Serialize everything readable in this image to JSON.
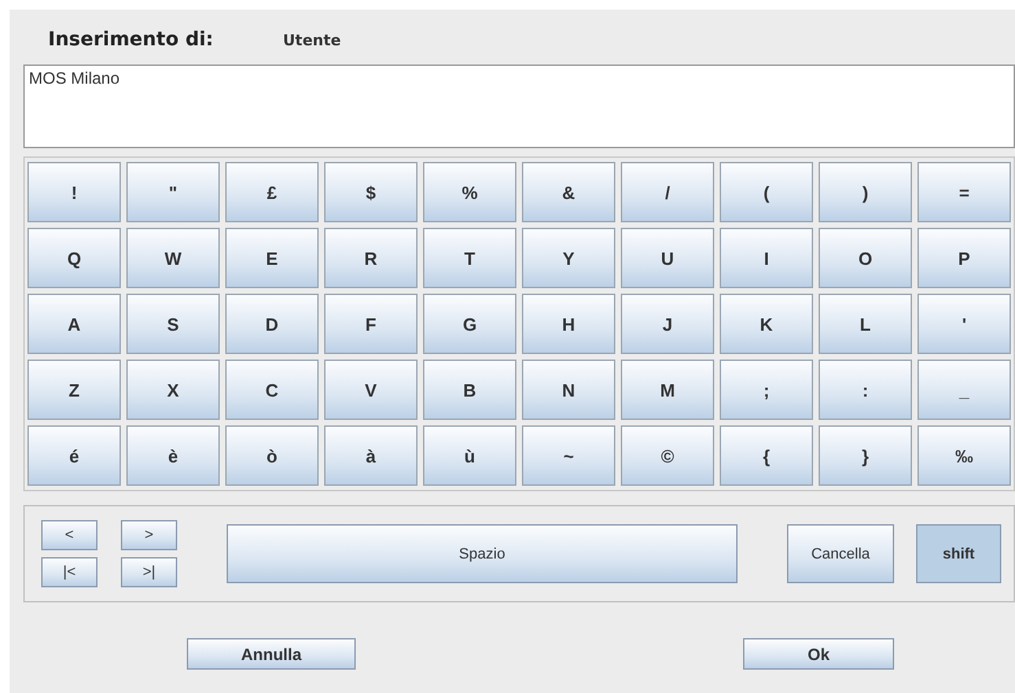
{
  "header": {
    "label": "Inserimento di:",
    "field_name": "Utente"
  },
  "input": {
    "value": "MOS Milano"
  },
  "keys": [
    [
      "!",
      "\"",
      "£",
      "$",
      "%",
      "&",
      "/",
      "(",
      ")",
      "="
    ],
    [
      "Q",
      "W",
      "E",
      "R",
      "T",
      "Y",
      "U",
      "I",
      "O",
      "P"
    ],
    [
      "A",
      "S",
      "D",
      "F",
      "G",
      "H",
      "J",
      "K",
      "L",
      "'"
    ],
    [
      "Z",
      "X",
      "C",
      "V",
      "B",
      "N",
      "M",
      ";",
      ":",
      "_"
    ],
    [
      "é",
      "è",
      "ò",
      "à",
      "ù",
      "~",
      "©",
      "{",
      "}",
      "‰"
    ]
  ],
  "nav_buttons": [
    "<",
    ">",
    "|<",
    ">|"
  ],
  "space_button": "Spazio",
  "delete_button": "Cancella",
  "shift": {
    "label": "shift",
    "on": true
  },
  "buttons": [
    "Annulla",
    "Ok"
  ]
}
